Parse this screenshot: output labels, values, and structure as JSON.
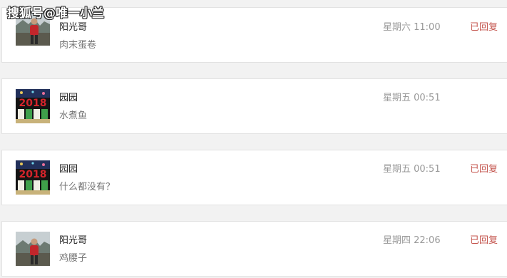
{
  "watermark": "搜狐号@唯一小兰",
  "messages": [
    {
      "name": "阳光哥",
      "preview": "肉末蛋卷",
      "time": "星期六 11:00",
      "status": "已回复",
      "avatar_icon": "person-photo-avatar-icon"
    },
    {
      "name": "园园",
      "preview": "水煮鱼",
      "time": "星期五 00:51",
      "status": "",
      "avatar_icon": "new-year-2018-avatar-icon"
    },
    {
      "name": "园园",
      "preview": "什么都没有？",
      "time": "星期五 00:51",
      "status": "已回复",
      "avatar_icon": "new-year-2018-avatar-icon"
    },
    {
      "name": "阳光哥",
      "preview": "鸡腰子",
      "time": "星期四 22:06",
      "status": "已回复",
      "avatar_icon": "person-photo-avatar-icon"
    }
  ],
  "colors": {
    "status_replied": "#c4554e",
    "time": "#999999",
    "name": "#222222",
    "preview": "#777777"
  }
}
